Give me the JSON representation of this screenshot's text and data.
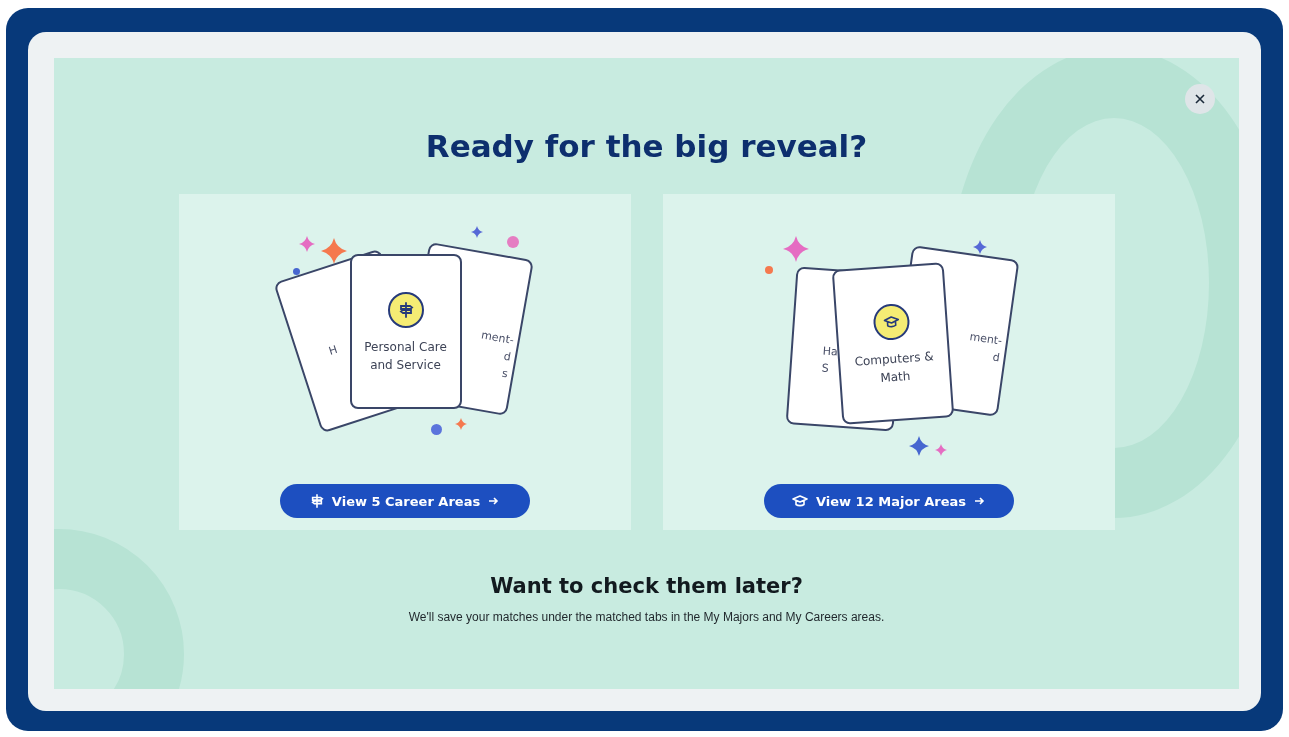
{
  "dialog": {
    "title": "Ready for the big reveal?",
    "options": [
      {
        "kind": "career",
        "front_card": {
          "label": "Personal Care and Service"
        },
        "back_cards": [
          {
            "fragments": [
              "H"
            ]
          },
          {
            "fragments": [
              "ment-",
              "d",
              "s"
            ]
          }
        ],
        "button": "View 5 Career Areas"
      },
      {
        "kind": "major",
        "front_card": {
          "label": "Computers & Math"
        },
        "back_cards": [
          {
            "fragments": [
              "Ha",
              "S"
            ]
          },
          {
            "fragments": [
              "ment-",
              "d"
            ]
          }
        ],
        "button": "View 12 Major Areas"
      }
    ],
    "later_heading": "Want to check them later?",
    "later_text": "We'll save your matches under the matched tabs in the My Majors and My Careers areas."
  }
}
